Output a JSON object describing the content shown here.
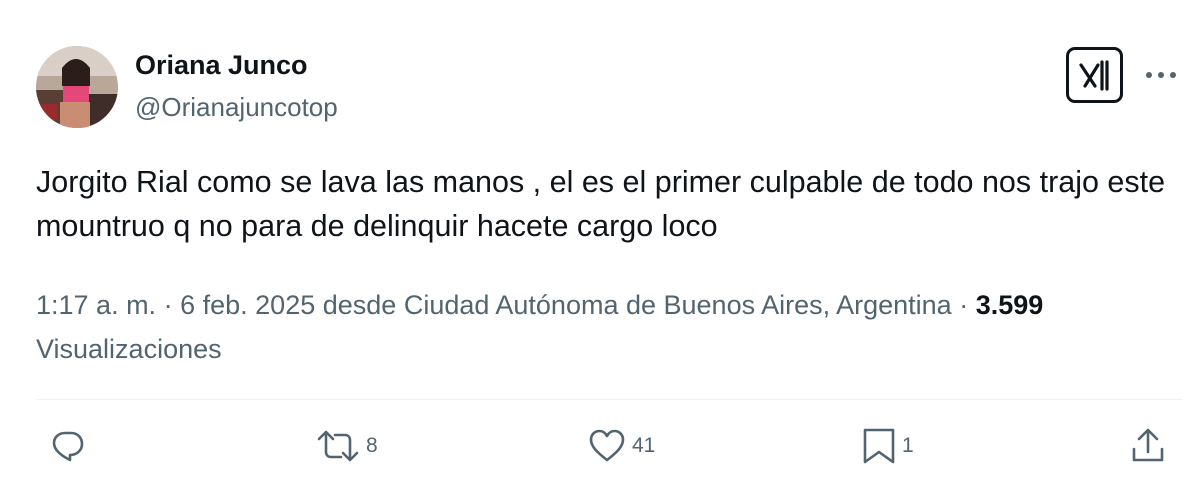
{
  "user": {
    "display_name": "Oriana Junco",
    "handle": "@Orianajuncotop"
  },
  "tweet": {
    "text": "Jorgito Rial como se lava las manos , el es el primer culpable de todo nos trajo este mountruo q no para de delinquir hacete cargo loco"
  },
  "meta": {
    "time": "1:17 a. m.",
    "separator": "·",
    "date": "6 feb. 2025",
    "source": "desde Ciudad Autónoma de Buenos Aires, Argentina",
    "views_count": "3.599",
    "views_label": "Visualizaciones"
  },
  "actions": {
    "reply_count": "",
    "repost_count": "8",
    "like_count": "41",
    "bookmark_count": "1"
  },
  "icons": {
    "grok": "grok-icon",
    "more": "more-dots-icon",
    "reply": "reply-icon",
    "repost": "repost-icon",
    "like": "heart-icon",
    "bookmark": "bookmark-icon",
    "share": "share-icon"
  },
  "colors": {
    "text": "#0f1419",
    "secondary": "#536471",
    "divider": "#eff3f4"
  }
}
